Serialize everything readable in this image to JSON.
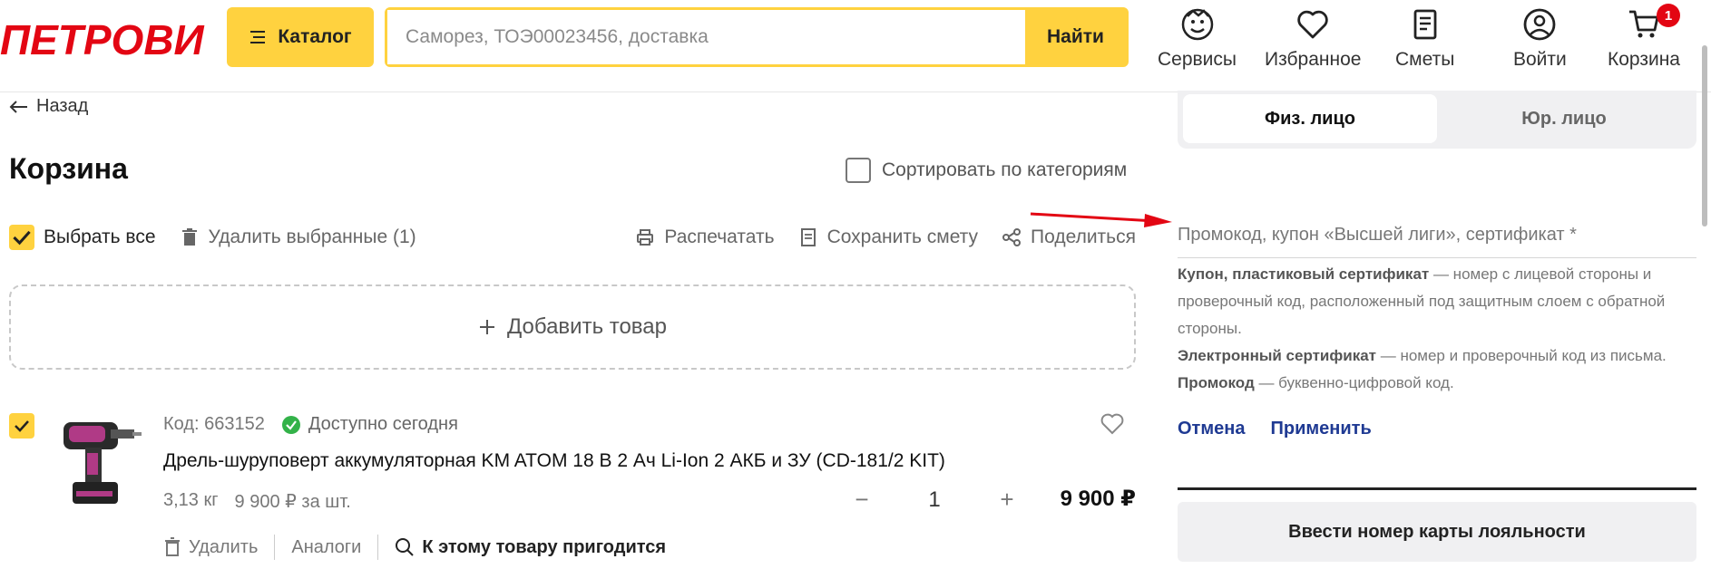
{
  "header": {
    "logo_text": "ПЕТРОВИЧ",
    "catalog_label": "Каталог",
    "search_placeholder": "Саморез, ТОЭ00023456, доставка",
    "search_button": "Найти",
    "nav": [
      {
        "label": "Сервисы",
        "icon": "mascot-icon"
      },
      {
        "label": "Избранное",
        "icon": "heart-icon"
      },
      {
        "label": "Сметы",
        "icon": "document-icon"
      },
      {
        "label": "Войти",
        "icon": "user-icon"
      },
      {
        "label": "Корзина",
        "icon": "cart-icon",
        "badge": "1"
      }
    ],
    "colors": {
      "brand_red": "#e30613",
      "accent_yellow": "#ffd23f"
    }
  },
  "cart": {
    "back_label": "Назад",
    "title": "Корзина",
    "sort_label": "Сортировать по категориям",
    "select_all_label": "Выбрать все",
    "delete_selected_label": "Удалить выбранные (1)",
    "print_label": "Распечатать",
    "save_estimate_label": "Сохранить смету",
    "share_label": "Поделиться",
    "add_product_label": "Добавить товар"
  },
  "product": {
    "code": "Код: 663152",
    "availability": "Доступно сегодня",
    "name": "Дрель-шуруповерт аккумуляторная KM ATOM 18 В 2 Ач Li-Ion 2 АКБ и ЗУ (CD-181/2 KIT)",
    "weight": "3,13 кг",
    "unit_price": "9 900 ₽ за шт.",
    "quantity": "1",
    "total_price": "9 900 ₽",
    "delete_label": "Удалить",
    "analogs_label": "Аналоги",
    "related_label": "К этому товару пригодится"
  },
  "side": {
    "tab_individual": "Физ. лицо",
    "tab_legal": "Юр. лицо",
    "promo_label": "Промокод, купон «Высшей лиги», сертификат *",
    "info": [
      {
        "bold": "Купон, пластиковый сертификат",
        "text": " — номер с лицевой стороны и проверочный код, расположенный под защитным слоем с обратной стороны."
      },
      {
        "bold": "Электронный сертификат",
        "text": " — номер и проверочный код из письма."
      },
      {
        "bold": "Промокод",
        "text": " — буквенно-цифровой код."
      }
    ],
    "cancel_label": "Отмена",
    "apply_label": "Применить",
    "loyalty_label": "Ввести номер карты лояльности"
  }
}
